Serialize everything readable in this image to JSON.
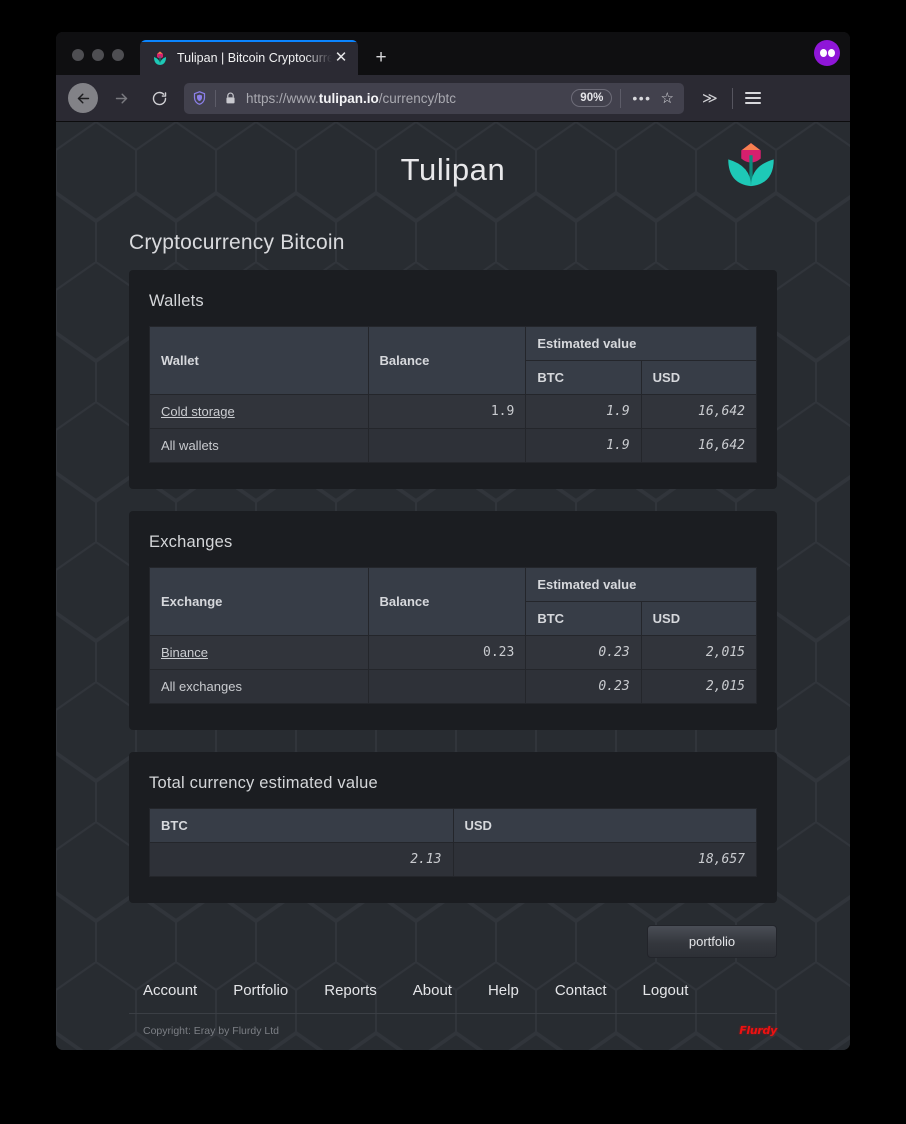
{
  "browser": {
    "tab": {
      "title": "Tulipan | Bitcoin Cryptocurrency",
      "favicon_name": "tulip-favicon",
      "close_label": "✕"
    },
    "new_tab_label": "+",
    "private_badge_name": "private-browsing-mask-icon",
    "toolbar": {
      "back_label": "←",
      "forward_label": "→",
      "reload_label": "⟳",
      "url_prefix": "https://www.",
      "url_domain": "tulipan.io",
      "url_path": "/currency/btc",
      "zoom_level": "90%",
      "more_label": "•••",
      "bookmark_label": "☆",
      "overflow_label": "≫"
    }
  },
  "site": {
    "brand": "Tulipan",
    "page_title": "Cryptocurrency Bitcoin"
  },
  "wallets": {
    "card_title": "Wallets",
    "columns": {
      "name": "Wallet",
      "balance": "Balance",
      "estimated": "Estimated value",
      "btc": "BTC",
      "usd": "USD"
    },
    "rows": [
      {
        "name": "Cold storage",
        "balance": "1.9",
        "btc": "1.9",
        "usd": "16,642",
        "is_link": true
      },
      {
        "name": "All wallets",
        "balance": "",
        "btc": "1.9",
        "usd": "16,642",
        "is_link": false
      }
    ]
  },
  "exchanges": {
    "card_title": "Exchanges",
    "columns": {
      "name": "Exchange",
      "balance": "Balance",
      "estimated": "Estimated value",
      "btc": "BTC",
      "usd": "USD"
    },
    "rows": [
      {
        "name": "Binance",
        "balance": "0.23",
        "btc": "0.23",
        "usd": "2,015",
        "is_link": true
      },
      {
        "name": "All exchanges",
        "balance": "",
        "btc": "0.23",
        "usd": "2,015",
        "is_link": false
      }
    ]
  },
  "totals": {
    "card_title": "Total currency estimated value",
    "columns": {
      "btc": "BTC",
      "usd": "USD"
    },
    "btc": "2.13",
    "usd": "18,657"
  },
  "actions": {
    "portfolio_button": "portfolio"
  },
  "footer": {
    "links": [
      "Account",
      "Portfolio",
      "Reports",
      "About",
      "Help",
      "Contact",
      "Logout"
    ],
    "copyright": "Copyright: Eray by Flurdy Ltd",
    "logo_text": "Flurdy"
  },
  "colors": {
    "page_bg": "#282c31",
    "card_bg": "#1b1d21",
    "table_header_bg": "#373d47",
    "table_cell_bg": "#31343b",
    "accent_tulip_pink": "#d61f6e",
    "accent_tulip_orange": "#f88050",
    "accent_tulip_teal": "#1ec9b7",
    "tab_accent": "#0a84ff",
    "private_purple": "#8f16d8",
    "flurdy_red": "#ee1111"
  }
}
